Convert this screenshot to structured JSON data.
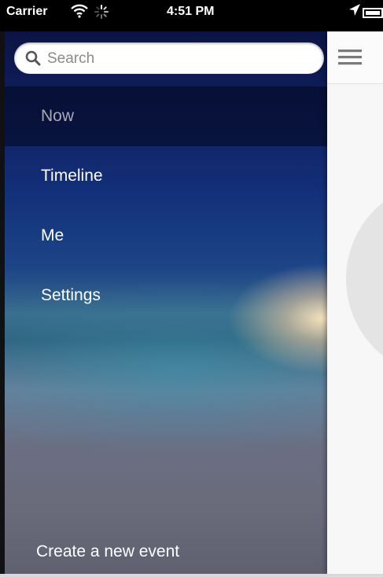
{
  "status_bar": {
    "carrier": "Carrier",
    "time": "4:51 PM"
  },
  "search": {
    "placeholder": "Search"
  },
  "menu": {
    "items": [
      {
        "label": "Now",
        "selected": true
      },
      {
        "label": "Timeline",
        "selected": false
      },
      {
        "label": "Me",
        "selected": false
      },
      {
        "label": "Settings",
        "selected": false
      }
    ],
    "create_label": "Create a new event"
  },
  "icons": {
    "search": "search-icon",
    "menu": "hamburger-icon",
    "wifi": "wifi-icon",
    "activity": "activity-spinner-icon",
    "location": "location-arrow-icon",
    "battery": "battery-icon"
  }
}
